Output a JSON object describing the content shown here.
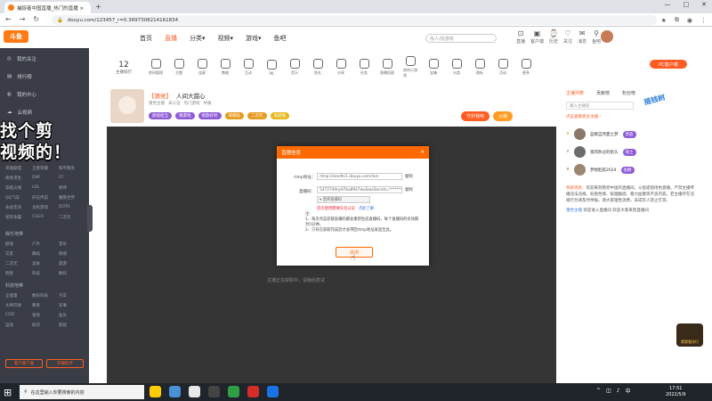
{
  "browser": {
    "tab_title": "捕捉者中国直播_热门的直播 × ",
    "new_tab": "+",
    "url": "douyu.com/123457_r=0.3697308214161834",
    "window_controls": [
      "—",
      "□",
      "✕"
    ]
  },
  "site": {
    "logo": "斗鱼",
    "nav": [
      "首页",
      "直播",
      "分类▾",
      "视频▾",
      "游戏▾",
      "鱼吧"
    ],
    "nav_active": "直播",
    "search_placeholder": "找人/找游戏",
    "header_icons": [
      {
        "label": "直播",
        "icon": "⊡"
      },
      {
        "label": "客户端",
        "icon": "▣"
      },
      {
        "label": "历史",
        "icon": "⌚"
      },
      {
        "label": "关注",
        "icon": "♡"
      },
      {
        "label": "消息",
        "icon": "✉"
      },
      {
        "label": "鱼吧",
        "icon": "⚲"
      }
    ]
  },
  "sidebar": {
    "items": [
      "我的关注",
      "排行榜",
      "我的中心",
      "云视频"
    ],
    "section1_grid": [
      "英雄联盟",
      "王者荣耀",
      "和平精英",
      "绝地求生",
      "DNF",
      "CF",
      "穿越火线",
      "LOL",
      "原神",
      "QQ飞车",
      "炉石传说",
      "魔兽世界",
      "永劫无间",
      "主机游戏",
      "DOTA",
      "星际争霸",
      "CSGO",
      "二次元"
    ],
    "section2_head": "娱乐地带",
    "section2_grid": [
      "颜值",
      "户外",
      "音乐",
      "交友",
      "舞蹈",
      "情感",
      "二次元",
      "美食",
      "旅游",
      "明星",
      "科技",
      "数码"
    ],
    "section3_head": "科技地带",
    "section3_grid": [
      "正能量",
      "数码科技",
      "汽车",
      "大神开讲",
      "教育",
      "军事",
      "COD",
      "星际",
      "鱼乐",
      "运动",
      "知识",
      "影视"
    ],
    "buttons": [
      "客户端下载",
      "开播助手"
    ],
    "overlay_text_line1": "找个剪",
    "overlay_text_line2": "视频的！"
  },
  "category_bar": {
    "rank_number": "12",
    "rank_label": "主播排行",
    "items": [
      "房间管理",
      "主题",
      "连麦",
      "数据",
      "互动",
      "PK",
      "音乐",
      "鱼丸",
      "分享",
      "任务",
      "直播回放",
      "房间小游戏",
      "宝箱",
      "分类",
      "图标",
      "活动",
      "更多"
    ],
    "pc_button": "PC客户端"
  },
  "room": {
    "tag": "【猜党】",
    "title": "人间大甜心",
    "sub": [
      "猜党主播",
      "未认证",
      "热门游戏",
      "举报"
    ],
    "tags": [
      "颜值担当",
      "猜游戏",
      "唱歌好听",
      "萌萌哒",
      "二次元",
      "高颜值"
    ],
    "follow": "守护我吧",
    "hot": "火爆"
  },
  "player": {
    "tip": "主播正在获取中，请稍后尝试"
  },
  "dialog": {
    "title": "直播信息",
    "close_x": "✕",
    "rtmp_label": "rtmp地址：",
    "rtmp_value": "rtmp://sendtc1.douyu.com/live",
    "copy1": "复制",
    "stream_label": "直播码：",
    "stream_value": "5472749ryH7bx8947wx&wsSecret=**********",
    "copy2": "复制",
    "select_value": "▾ 选择直播码",
    "warn": "首次使用需要实名认证",
    "warn_link": "点此了解",
    "note_title": "注：",
    "note1": "1、每次点击获取直播码都会重新生成直播码，每个直播码的有效期为5分钟。",
    "note2": "2、只有在获取完成后才会带回rtmp地址发放至此。",
    "close_button": "关闭"
  },
  "right_panel": {
    "tabs": [
      "主播列表",
      "贡献榜",
      "粉丝榜"
    ],
    "tabs_active": "主播列表",
    "search_placeholder": "输入主播名",
    "link": "点击查看更多主播 ›",
    "badge": "摇钱树",
    "ranks": [
      {
        "name": "蓝鲸自然夏之梦",
        "badge": "贵族"
      },
      {
        "name": "夜风吹过的街头",
        "badge": "骑士"
      },
      {
        "name": "梦想起航2024",
        "badge": "伯爵"
      }
    ],
    "chat_sys": "系统消息：",
    "chat_text": "欢迎来到猜党中国的直播间。斗鱼提倡绿色直播，严禁主播传播违法违规、低俗色情、吸烟酗酒、暴力血腥等不良内容。若主播存在违规行为请及时举报。请大家理性消费，未成年人禁止打赏。",
    "chat_name": "猜党主播",
    "chat_msg": "欢迎进入直播间 欢迎大家来到直播间",
    "float_badge": "猜猜看排行"
  },
  "taskbar": {
    "search_placeholder": "在这里输入你要搜索的内容",
    "time": "17:51",
    "date": "2022/5/9",
    "app_colors": [
      "#ffcc00",
      "#4a90d9",
      "#e8e8e8",
      "#444",
      "#2f9e44",
      "#d62c2c",
      "#1a73e8"
    ]
  },
  "colors": {
    "brand": "#ff5d23",
    "dialog_header": "#ff6a00",
    "sidebar_bg": "#3a3d45",
    "player_bg": "#353535"
  }
}
